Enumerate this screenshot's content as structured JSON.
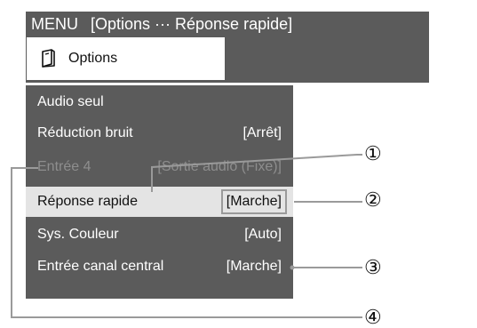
{
  "menu_bar": {
    "menu_label": "MENU",
    "path": "[Options ··· Réponse rapide]"
  },
  "options_tab": {
    "icon": "options-icon",
    "label": "Options"
  },
  "menu_items": [
    {
      "label": "Audio seul",
      "value": "",
      "state": "normal"
    },
    {
      "label": "Réduction bruit",
      "value": "[Arrêt]",
      "state": "normal"
    },
    {
      "label": "Entrée 4",
      "value": "[Sortie audio (Fixe)]",
      "state": "disabled"
    },
    {
      "label": "Réponse rapide",
      "value": "[Marche]",
      "state": "selected"
    },
    {
      "label": "Sys. Couleur",
      "value": "[Auto]",
      "state": "normal"
    },
    {
      "label": "Entrée canal central",
      "value": "[Marche]",
      "state": "normal"
    }
  ],
  "callouts": [
    "①",
    "②",
    "③",
    "④"
  ],
  "colors": {
    "menu_background": "#5b5b5b",
    "selected_row": "#e4e4e4",
    "disabled_text": "#8e8e8e",
    "callout_line": "#9a9a9a"
  }
}
